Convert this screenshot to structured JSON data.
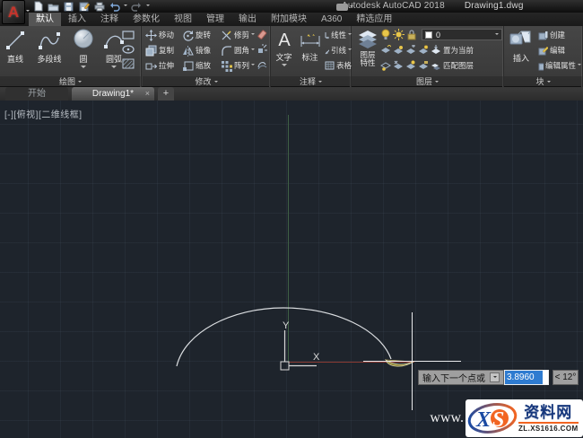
{
  "titlebar": {
    "app_logo": "A",
    "app_title": "Autodesk AutoCAD 2018",
    "doc_title": "Drawing1.dwg"
  },
  "ribbon": {
    "tabs": [
      "默认",
      "插入",
      "注释",
      "参数化",
      "视图",
      "管理",
      "输出",
      "附加模块",
      "A360",
      "精选应用"
    ],
    "active_tab": "默认"
  },
  "panels": {
    "draw": {
      "label": "绘图",
      "buttons": [
        "直线",
        "多段线",
        "圆",
        "圆弧"
      ]
    },
    "modify": {
      "label": "修改",
      "buttons": [
        "移动",
        "旋转",
        "修剪",
        "复制",
        "镜像",
        "圆角",
        "拉伸",
        "缩放",
        "阵列"
      ]
    },
    "annotation": {
      "label": "注释",
      "text": "文字",
      "dimension": "标注",
      "rows": [
        "线性",
        "引线",
        "表格"
      ]
    },
    "layers": {
      "label": "图层",
      "properties": "图层特性",
      "current_layer": "0",
      "set_current": "置为当前",
      "match_layer": "匹配图层"
    },
    "block": {
      "label": "块",
      "insert": "插入",
      "rows": [
        "创建",
        "编辑",
        "编辑属性"
      ]
    }
  },
  "file_tabs": {
    "start": "开始",
    "doc": "Drawing1*",
    "close": "×",
    "add": "+"
  },
  "viewport": {
    "controls": "[-][俯视][二维线框]",
    "axis_x": "X",
    "axis_y": "Y"
  },
  "dynamic_input": {
    "prompt": "输入下一个点或",
    "value": "3.8960",
    "angle": "< 12°"
  },
  "watermark": {
    "www": "www.",
    "logo_x": "X",
    "logo_s": "S",
    "site": "资料网",
    "url": "ZL.XS1616.COM"
  },
  "icons": {
    "qat": [
      "new-file",
      "open-folder",
      "save-disk",
      "save-as-disk",
      "plot-printer",
      "undo-arrow",
      "redo-arrow"
    ],
    "draw": [
      "line",
      "polyline",
      "circle",
      "arc",
      "rectangle",
      "ellipse",
      "hatch"
    ],
    "modify": [
      "move",
      "rotate",
      "trim",
      "copy",
      "mirror",
      "fillet",
      "stretch",
      "scale",
      "array",
      "erase",
      "explode",
      "offset"
    ],
    "layers": [
      "bulb",
      "sun",
      "lock",
      "layer-stack"
    ],
    "block": [
      "insert-cubes",
      "create-block",
      "edit-block",
      "edit-attributes"
    ]
  },
  "colors": {
    "canvas_bg": "#1e242c",
    "axis_green": "#3f5f45",
    "axis_red": "#8a3a33",
    "selection_blue": "#2e7bd0",
    "steel_icon": "#b7c6d8",
    "logo_red": "#c6332b",
    "watermark_orange": "#f26522",
    "watermark_blue": "#16377c"
  }
}
